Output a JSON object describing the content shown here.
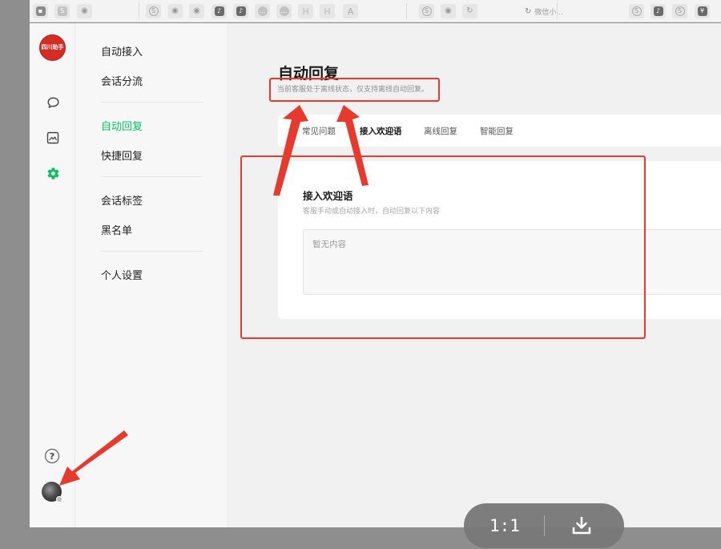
{
  "tabbar": {
    "wechat_mini_label": "微信小..."
  },
  "app": {
    "logo_text": "四川助手"
  },
  "menu": {
    "groups": [
      [
        "自动接入",
        "会话分流"
      ],
      [
        "自动回复",
        "快捷回复"
      ],
      [
        "会话标签",
        "黑名单"
      ],
      [
        "个人设置"
      ]
    ],
    "active_item": "自动回复"
  },
  "main": {
    "title": "自动回复",
    "subtitle": "当前客服处于离线状态，仅支持离线自动回复。",
    "tabs": [
      "常见问题",
      "接入欢迎语",
      "离线回复",
      "智能回复"
    ],
    "active_tab": "接入欢迎语",
    "card": {
      "title": "接入欢迎语",
      "description": "客服手动或自动接入时，自动回复以下内容",
      "placeholder": "暂无内容"
    }
  },
  "viewer": {
    "zoom_label": "1:1"
  },
  "icons": {
    "rail": [
      "chat-bubble-icon",
      "image-frame-icon",
      "gear-icon"
    ],
    "help": "question-mark-icon",
    "download": "download-icon"
  },
  "colors": {
    "accent_green": "#07c160",
    "annotation_red": "#e53a2d",
    "logo_red": "#d42d23"
  }
}
